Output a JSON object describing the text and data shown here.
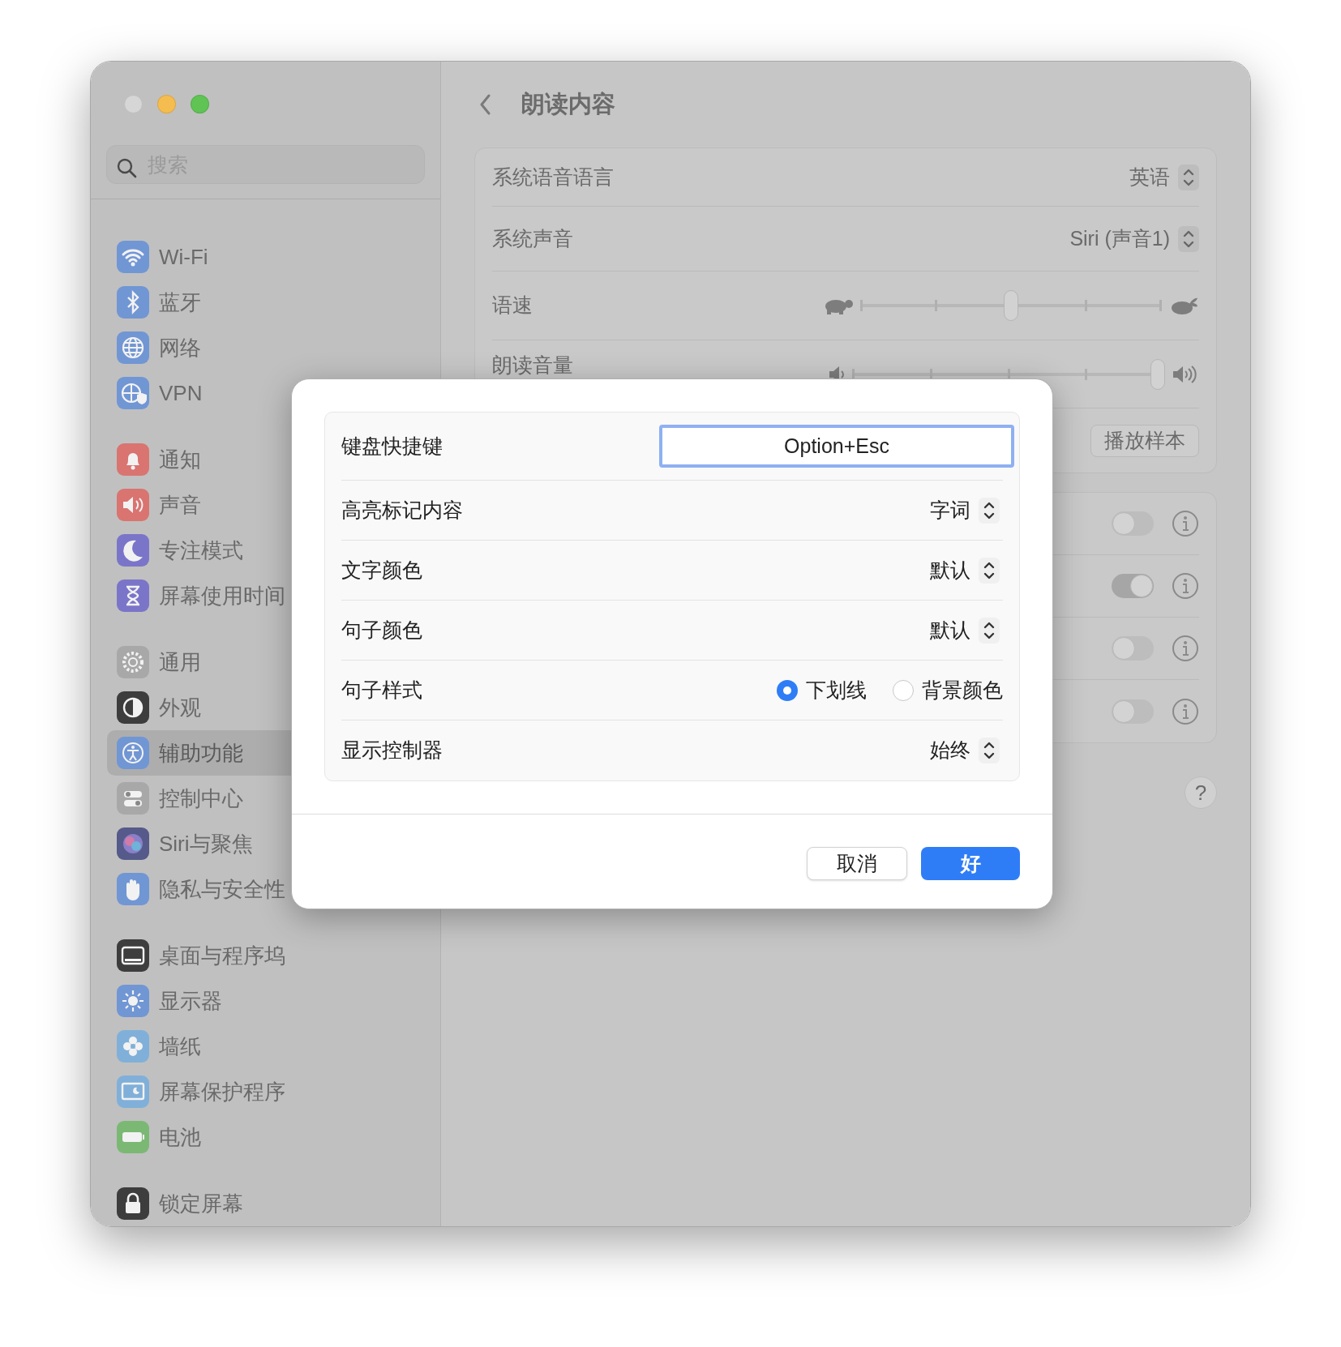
{
  "window": {
    "traffic_lights": [
      {
        "color": "#d6d6d6"
      },
      {
        "color": "#f5bd4f"
      },
      {
        "color": "#5fc454"
      }
    ]
  },
  "sidebar": {
    "search": {
      "placeholder": "搜索"
    },
    "groups": [
      [
        {
          "label": "Wi-Fi",
          "selected": false
        },
        {
          "label": "蓝牙",
          "selected": false
        },
        {
          "label": "网络",
          "selected": false
        },
        {
          "label": "VPN",
          "selected": false
        }
      ],
      [
        {
          "label": "通知",
          "selected": false
        },
        {
          "label": "声音",
          "selected": false
        },
        {
          "label": "专注模式",
          "selected": false
        },
        {
          "label": "屏幕使用时间",
          "selected": false
        }
      ],
      [
        {
          "label": "通用",
          "selected": false
        },
        {
          "label": "外观",
          "selected": false
        },
        {
          "label": "辅助功能",
          "selected": true
        },
        {
          "label": "控制中心",
          "selected": false
        },
        {
          "label": "Siri与聚焦",
          "selected": false
        },
        {
          "label": "隐私与安全性",
          "selected": false
        }
      ],
      [
        {
          "label": "桌面与程序坞",
          "selected": false
        },
        {
          "label": "显示器",
          "selected": false
        },
        {
          "label": "墙纸",
          "selected": false
        },
        {
          "label": "屏幕保护程序",
          "selected": false
        },
        {
          "label": "电池",
          "selected": false
        }
      ],
      [
        {
          "label": "锁定屏幕",
          "selected": false
        }
      ]
    ]
  },
  "content": {
    "title": "朗读内容",
    "voice_settings": [
      {
        "kind": "popup",
        "label": "系统语音语言",
        "value": "英语"
      },
      {
        "kind": "popup",
        "label": "系统声音",
        "value": "Siri (声音1)"
      },
      {
        "kind": "speed",
        "label": "语速",
        "level": 0.5
      },
      {
        "kind": "volume",
        "label": "朗读音量",
        "level": 1
      },
      {
        "kind": "button",
        "button": "播放样本"
      }
    ],
    "options": [
      {
        "on": false
      },
      {
        "on": true
      },
      {
        "on": false
      },
      {
        "on": false
      }
    ],
    "help": "?"
  },
  "dialog": {
    "rows": [
      {
        "kind": "shortcut",
        "label": "键盘快捷键",
        "value": "Option+Esc"
      },
      {
        "kind": "popup",
        "label": "高亮标记内容",
        "value": "字词"
      },
      {
        "kind": "popup",
        "label": "文字颜色",
        "value": "默认"
      },
      {
        "kind": "popup",
        "label": "句子颜色",
        "value": "默认"
      },
      {
        "kind": "radio",
        "label": "句子样式",
        "options": [
          {
            "label": "下划线",
            "selected": true
          },
          {
            "label": "背景颜色",
            "selected": false
          }
        ]
      },
      {
        "kind": "popup",
        "label": "显示控制器",
        "value": "始终"
      }
    ],
    "buttons": [
      {
        "kind": "cancel",
        "label": "取消"
      },
      {
        "kind": "default",
        "label": "好"
      }
    ]
  }
}
